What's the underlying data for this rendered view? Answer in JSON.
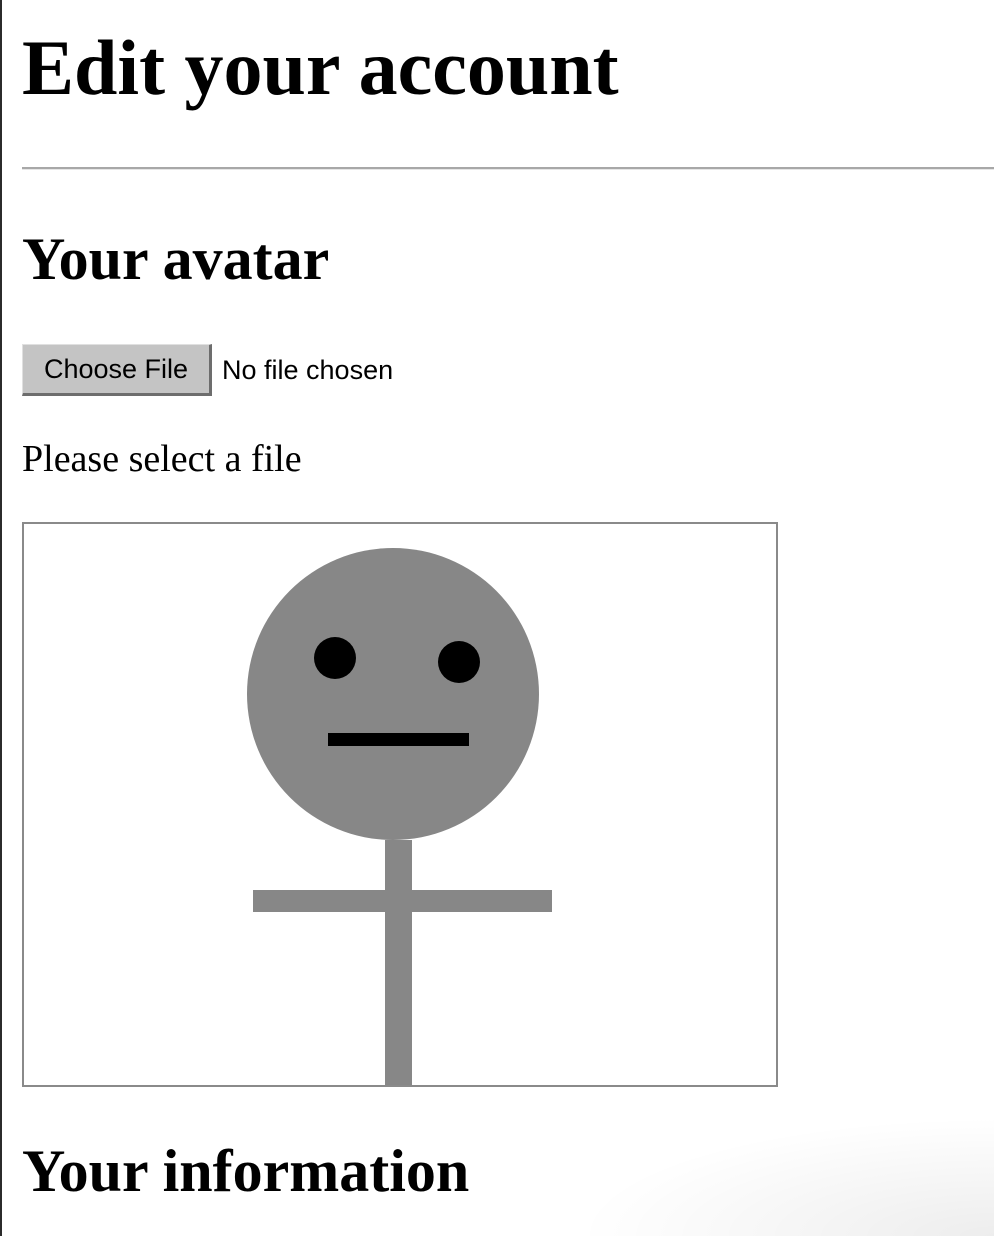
{
  "page": {
    "title": "Edit your account"
  },
  "avatar_section": {
    "heading": "Your avatar",
    "file_input": {
      "button_label": "Choose File",
      "status": "No file chosen"
    },
    "hint": "Please select a file"
  },
  "info_section": {
    "heading": "Your information"
  },
  "colors": {
    "figure_gray": "#878787",
    "eye": "#000000",
    "mouth": "#000000",
    "frame_border": "#8a8a8a",
    "button_face": "#c4c4c4"
  },
  "icons": {
    "avatar_preview": "stick-figure-neutral-face"
  }
}
